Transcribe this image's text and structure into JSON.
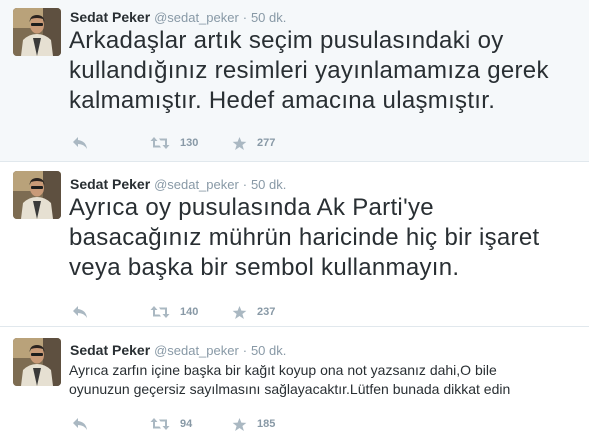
{
  "colors": {
    "highlight_bg": "#f5f8fa",
    "name": "#292f33",
    "meta": "#8899a6",
    "divider": "#e1e8ed"
  },
  "tweets": [
    {
      "name": "Sedat Peker",
      "handle": "@sedat_peker",
      "dot": "·",
      "time": "50 dk.",
      "lines": [
        "Arkadaşlar artık seçim pusulasındaki oy",
        "kullandığınız resimleri yayınlamamıza gerek",
        "kalmamıştır. Hedef amacına ulaşmıştır."
      ],
      "retweets": "130",
      "favorites": "277"
    },
    {
      "name": "Sedat Peker",
      "handle": "@sedat_peker",
      "dot": "·",
      "time": "50 dk.",
      "lines": [
        "Ayrıca oy pusulasında Ak Parti'ye",
        "basacağınız mührün haricinde hiç bir işaret",
        "veya başka bir sembol kullanmayın."
      ],
      "retweets": "140",
      "favorites": "237"
    },
    {
      "name": "Sedat Peker",
      "handle": "@sedat_peker",
      "dot": "·",
      "time": "50 dk.",
      "lines": [
        "Ayrıca zarfın içine başka bir kağıt koyup ona not yazsanız dahi,O bile",
        "oyunuzun geçersiz sayılmasını sağlayacaktır.Lütfen bunada dikkat edin"
      ],
      "retweets": "94",
      "favorites": "185"
    }
  ],
  "icons": {
    "reply": "reply-icon",
    "retweet": "retweet-icon",
    "favorite": "star-icon"
  }
}
